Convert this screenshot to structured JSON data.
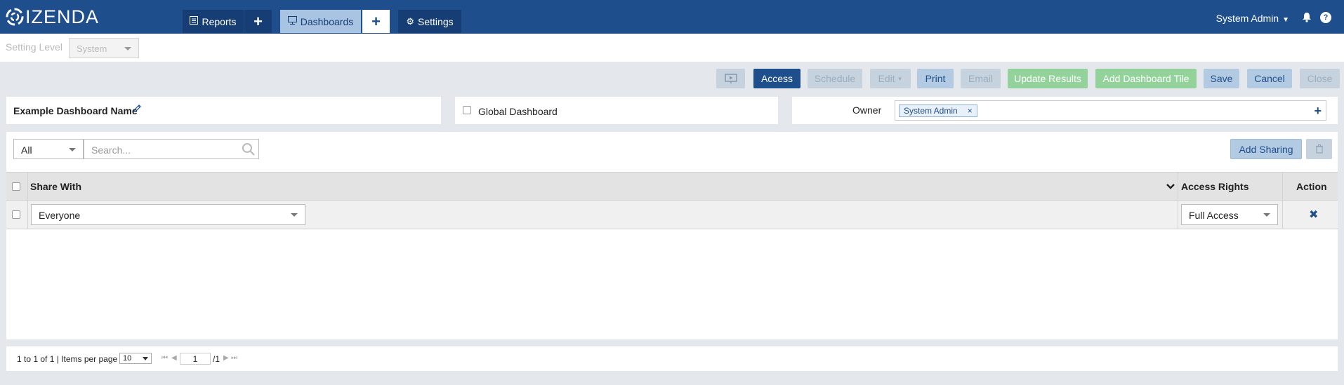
{
  "app": {
    "logo_text": "IZENDA"
  },
  "nav": {
    "reports": "Reports",
    "dashboards": "Dashboards",
    "settings": "Settings",
    "user": "System Admin"
  },
  "setting_level": {
    "label": "Setting Level",
    "value": "System"
  },
  "toolbar": {
    "access": "Access",
    "schedule": "Schedule",
    "edit": "Edit",
    "print": "Print",
    "email": "Email",
    "update_results": "Update Results",
    "add_dashboard_tile": "Add Dashboard Tile",
    "save": "Save",
    "cancel": "Cancel",
    "close": "Close"
  },
  "dashboard": {
    "name": "Example Dashboard Name",
    "global_label": "Global Dashboard",
    "global_checked": false,
    "owner_label": "Owner",
    "owner_tag": "System Admin"
  },
  "sharing": {
    "filter_value": "All",
    "search_placeholder": "Search...",
    "add_sharing": "Add Sharing",
    "columns": {
      "share_with": "Share With",
      "access_rights": "Access Rights",
      "action": "Action"
    },
    "rows": [
      {
        "share_with": "Everyone",
        "access_rights": "Full Access"
      }
    ]
  },
  "pager": {
    "summary": "1 to 1 of 1 | Items per page",
    "per_page": "10",
    "current_page": "1",
    "total_pages": "/1"
  },
  "colors": {
    "brand": "#1f4e8c",
    "green": "#94d29c"
  }
}
